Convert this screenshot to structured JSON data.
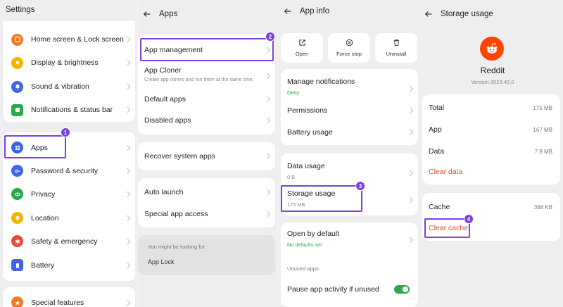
{
  "panel1": {
    "title": "Settings",
    "items_top": [
      {
        "label": "Home screen & Lock screen",
        "icon": "home-screen-icon",
        "color": "#f07b22"
      },
      {
        "label": "Display & brightness",
        "icon": "sun-icon",
        "color": "#f5b400"
      },
      {
        "label": "Sound & vibration",
        "icon": "bell-icon",
        "color": "#3f64e6"
      },
      {
        "label": "Notifications & status bar",
        "icon": "notification-icon",
        "color": "#2aa84a"
      }
    ],
    "items_mid": [
      {
        "label": "Apps",
        "icon": "apps-grid-icon",
        "color": "#3f64e6"
      },
      {
        "label": "Password & security",
        "icon": "key-icon",
        "color": "#3f64e6"
      },
      {
        "label": "Privacy",
        "icon": "eye-icon",
        "color": "#2aa84a"
      },
      {
        "label": "Location",
        "icon": "location-pin-icon",
        "color": "#f5b400"
      },
      {
        "label": "Safety & emergency",
        "icon": "asterisk-icon",
        "color": "#e24b3b"
      },
      {
        "label": "Battery",
        "icon": "battery-icon",
        "color": "#3f64e6"
      }
    ],
    "items_bottom": [
      {
        "label": "Special features",
        "icon": "star-icon",
        "color": "#f07b22"
      }
    ],
    "badge": "1"
  },
  "panel2": {
    "title": "Apps",
    "app_management": "App management",
    "app_cloner": "App Cloner",
    "app_cloner_sub": "Create app clones and run them at the same time.",
    "default_apps": "Default apps",
    "disabled_apps": "Disabled apps",
    "recover_system_apps": "Recover system apps",
    "auto_launch": "Auto launch",
    "special_app_access": "Special app access",
    "looking_for": "You might be looking for:",
    "app_lock": "App Lock",
    "badge": "2"
  },
  "panel3": {
    "title": "App info",
    "actions": {
      "open": "Open",
      "force_stop": "Force stop",
      "uninstall": "Uninstall"
    },
    "manage_notifications": "Manage notifications",
    "manage_notifications_sub": "Deny",
    "permissions": "Permissions",
    "battery_usage": "Battery usage",
    "data_usage": "Data usage",
    "data_usage_sub": "0 B",
    "storage_usage": "Storage usage",
    "storage_usage_sub": "175 MB",
    "open_by_default": "Open by default",
    "open_by_default_sub": "No defaults set",
    "unused_apps": "Unused apps",
    "pause_activity": "Pause app activity if unused",
    "pause_activity_on": true,
    "badge": "3"
  },
  "panel4": {
    "title": "Storage usage",
    "app_name": "Reddit",
    "version": "Version 2023.45.0",
    "total_label": "Total",
    "total_value": "175 MB",
    "app_label": "App",
    "app_value": "167 MB",
    "data_label": "Data",
    "data_value": "7.8 MB",
    "clear_data": "Clear data",
    "cache_label": "Cache",
    "cache_value": "368 KB",
    "clear_cache": "Clear cache",
    "brand_color": "#ff4500",
    "badge": "4"
  }
}
